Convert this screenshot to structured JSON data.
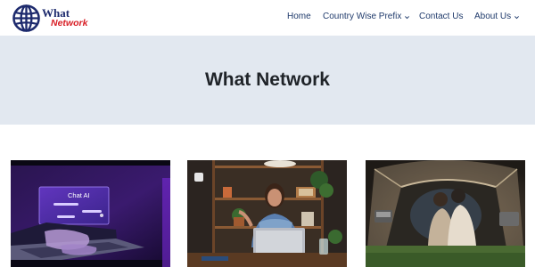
{
  "site": {
    "logo": {
      "line1": "What",
      "line2": "Network"
    }
  },
  "nav": {
    "items": [
      {
        "label": "Home",
        "has_dropdown": false
      },
      {
        "label": "Country Wise Prefix",
        "has_dropdown": true
      },
      {
        "label": "Contact Us",
        "has_dropdown": false
      },
      {
        "label": "About Us",
        "has_dropdown": true
      }
    ]
  },
  "hero": {
    "title": "What Network"
  },
  "cards": [
    {
      "image": "laptop-chat-ai-image",
      "overlay_text": "Chat AI"
    },
    {
      "image": "woman-with-laptop-image"
    },
    {
      "image": "camping-tent-night-image"
    }
  ],
  "colors": {
    "hero_bg": "#e2e8f0",
    "nav_text": "#1f3a6b",
    "logo_blue": "#1d2a6d",
    "logo_red": "#d81f26"
  }
}
